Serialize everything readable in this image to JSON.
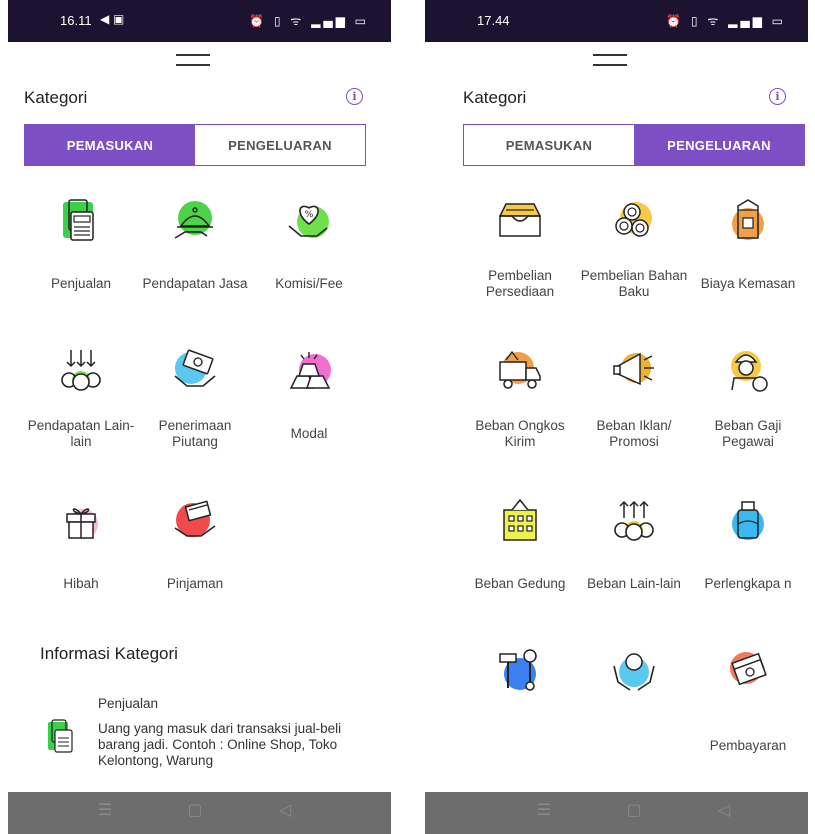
{
  "screens": [
    {
      "status_time": "16.11",
      "status_left_icons": "◀ ▣",
      "status_right_icons": "⏰ ▯ ᯤ ▂▄▆ ▭",
      "title": "Kategori",
      "info_icon_glyph": "i",
      "tabs": [
        {
          "label": "PEMASUKAN",
          "active": true
        },
        {
          "label": "PENGELUARAN",
          "active": false
        }
      ],
      "categories": [
        {
          "label": "Penjualan",
          "icon": "cash-register-icon"
        },
        {
          "label": "Pendapatan Jasa",
          "icon": "service-tray-icon"
        },
        {
          "label": "Komisi/Fee",
          "icon": "heart-percent-icon"
        },
        {
          "label": "Pendapatan Lain-lain",
          "icon": "coins-arrows-icon"
        },
        {
          "label": "Penerimaan Piutang",
          "icon": "receivable-hand-icon"
        },
        {
          "label": "Modal",
          "icon": "gold-bars-icon"
        },
        {
          "label": "Hibah",
          "icon": "gift-icon"
        },
        {
          "label": "Pinjaman",
          "icon": "loan-hand-icon"
        }
      ],
      "info": {
        "title": "Informasi Kategori",
        "name": "Penjualan",
        "description": "Uang yang masuk dari transaksi jual-beli barang jadi. Contoh : Online Shop, Toko Kelontong, Warung"
      }
    },
    {
      "status_time": "17.44",
      "status_right_icons": "⏰ ▯ ᯤ ▂▄▆ ▭",
      "title": "Kategori",
      "info_icon_glyph": "i",
      "tabs": [
        {
          "label": "PEMASUKAN",
          "active": false
        },
        {
          "label": "PENGELUARAN",
          "active": true
        }
      ],
      "categories": [
        {
          "label": "Pembelian Persediaan",
          "icon": "inventory-tray-icon"
        },
        {
          "label": "Pembelian Bahan Baku",
          "icon": "raw-logs-icon"
        },
        {
          "label": "Biaya Kemasan",
          "icon": "package-box-icon"
        },
        {
          "label": "Beban Ongkos Kirim",
          "icon": "delivery-truck-icon"
        },
        {
          "label": "Beban Iklan/ Promosi",
          "icon": "megaphone-icon"
        },
        {
          "label": "Beban Gaji Pegawai",
          "icon": "worker-salary-icon"
        },
        {
          "label": "Beban Gedung",
          "icon": "building-icon"
        },
        {
          "label": "Beban Lain-lain",
          "icon": "coins-arrows-up-icon"
        },
        {
          "label": "Perlengkapa n",
          "icon": "supplies-jar-icon"
        },
        {
          "label": "",
          "icon": "tools-icon"
        },
        {
          "label": "",
          "icon": "coin-hands-icon"
        },
        {
          "label": "Pembayaran",
          "icon": "payment-cash-icon"
        }
      ]
    }
  ],
  "navbar": {
    "menu_glyph": "☰",
    "home_glyph": "▢",
    "back_glyph": "◁"
  },
  "colors": {
    "accent": "#7c4fc4",
    "statusbar": "#1c1333",
    "navbar": "#6d6d6d"
  }
}
